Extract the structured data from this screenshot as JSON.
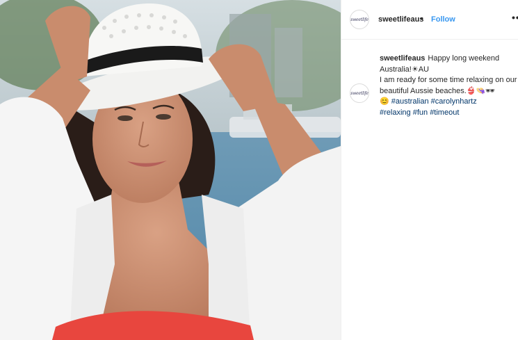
{
  "post": {
    "username": "sweetlifeaus",
    "separator": "•",
    "follow_label": "Follow",
    "more_label": "•••",
    "avatar_text": "sweetlife",
    "caption": {
      "username": "sweetlifeaus",
      "line1": "Happy long weekend Australia!",
      "line1_emoji": "☀AU",
      "line2": "I am ready for some time relaxing on our beautiful Aussie beaches.",
      "line2_emoji": "👙👒🕶",
      "smile_emoji": "😊",
      "hashtags": [
        "#australian",
        "#carolynhartz",
        "#relaxing",
        "#fun",
        "#timeout"
      ]
    }
  },
  "colors": {
    "follow": "#3897f0",
    "hashtag": "#003569",
    "swimsuit": "#e8463e"
  }
}
